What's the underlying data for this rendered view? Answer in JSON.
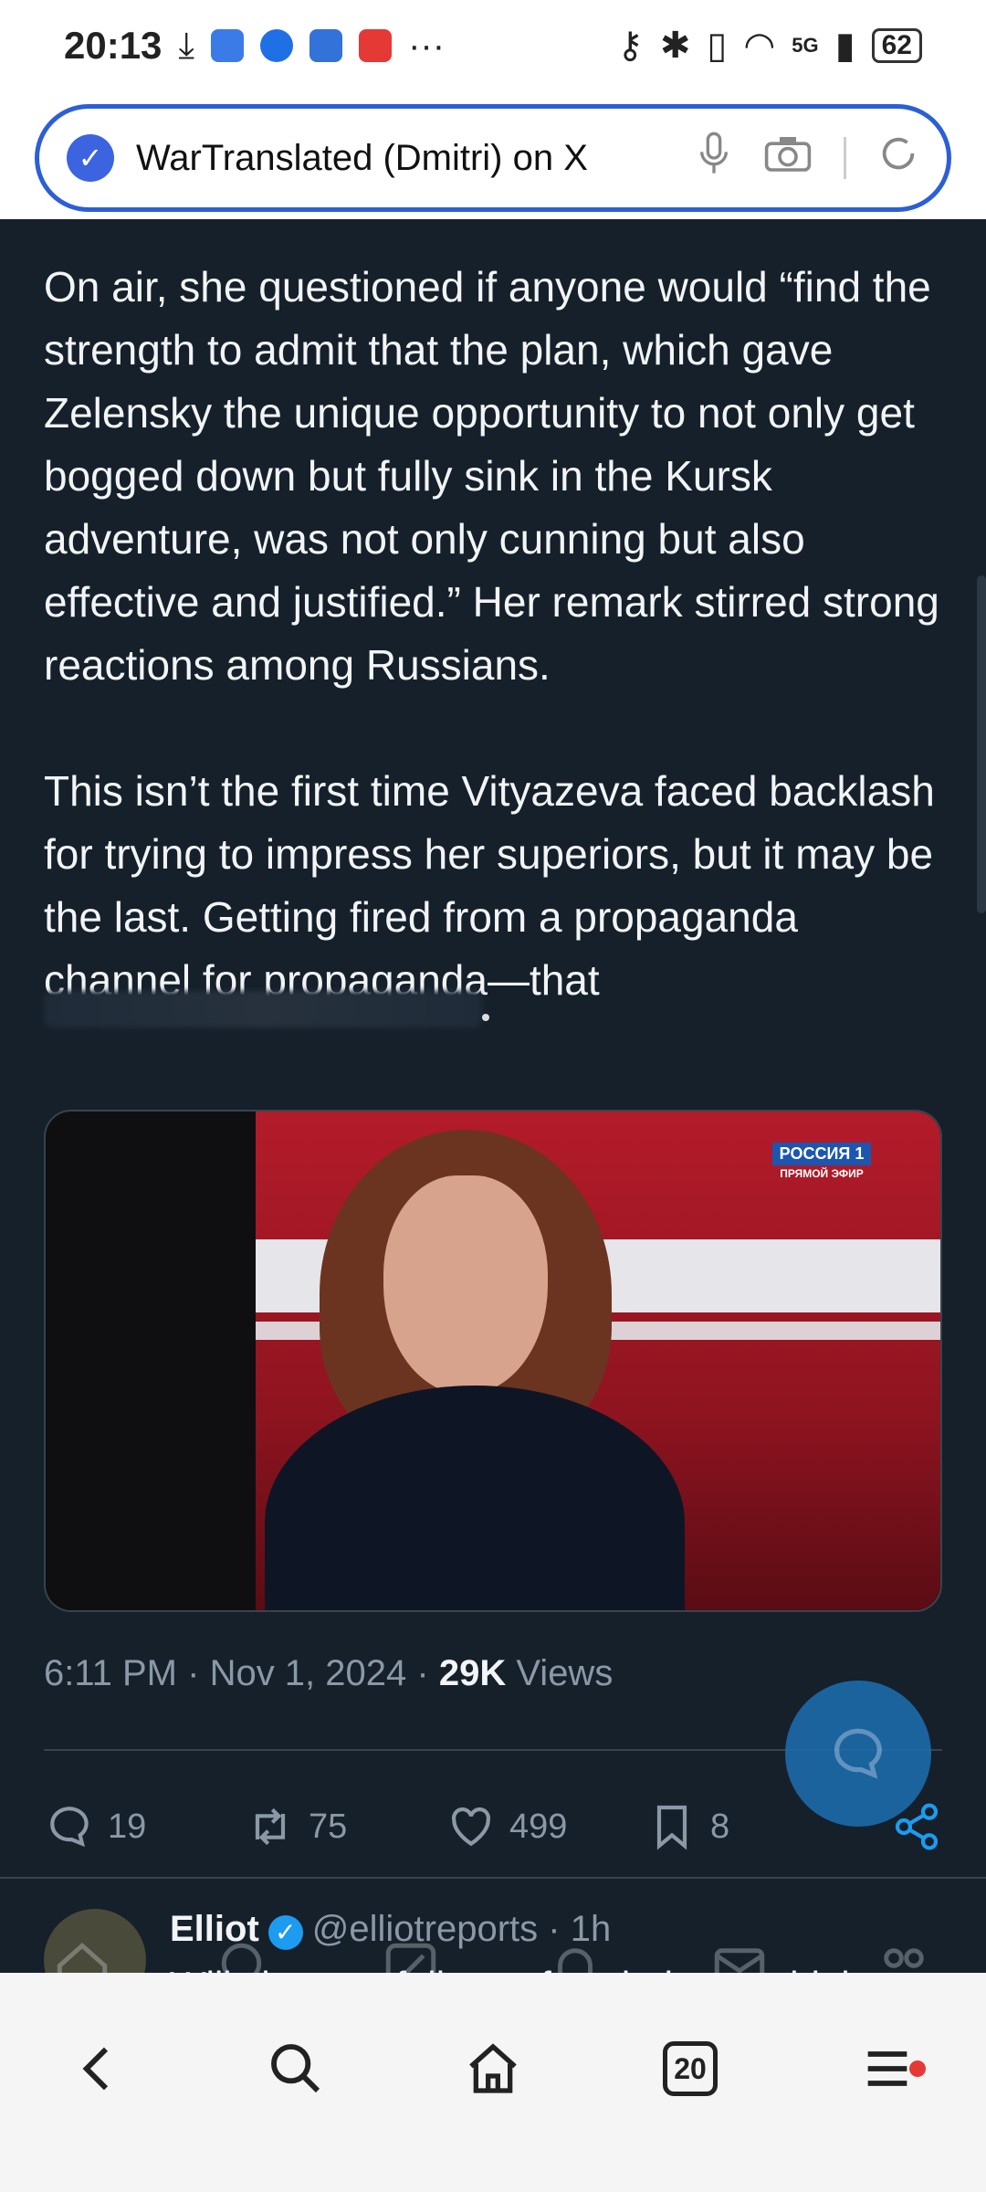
{
  "status_bar": {
    "time": "20:13",
    "battery": "62",
    "network": "5G"
  },
  "url_bar": {
    "title": "WarTranslated (Dmitri) on X"
  },
  "tweet": {
    "paragraph1": "On air, she questioned if anyone would “find the strength to admit that the plan, which gave Zelensky the unique opportunity to not only get bogged down but fully sink in the Kursk adventure, was not only cunning but also effective and justified.” Her remark stirred strong reactions among Russians.",
    "paragraph2": "This isn’t the first time Vityazeva faced backlash for trying to impress her superiors, but it may be the last. Getting fired from a propaganda channel for propaganda—that",
    "media_channel": "РОССИЯ 1",
    "media_channel_sub": "ПРЯМОЙ ЭФИР",
    "time": "6:11 PM",
    "date": "Nov 1, 2024",
    "views_count": "29K",
    "views_label": "Views",
    "replies": "19",
    "reposts": "75",
    "likes": "499",
    "bookmarks": "8"
  },
  "reply": {
    "name": "Elliot",
    "handle": "@elliotreports",
    "age": "1h",
    "text": "Will she now fall out of a window or drink a"
  },
  "browser_bar": {
    "tab_count": "20"
  }
}
